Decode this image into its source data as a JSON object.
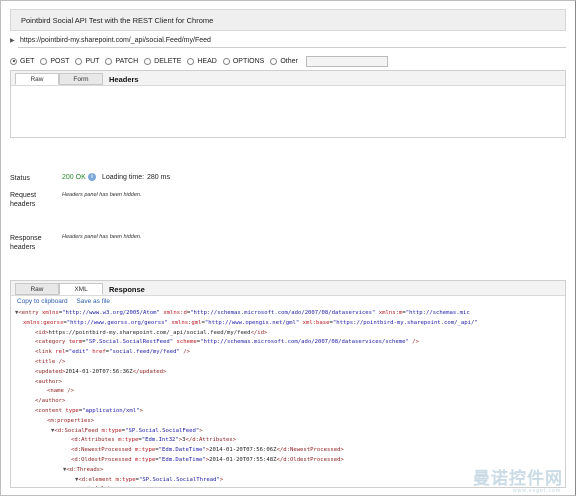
{
  "app": {
    "title": "Pointbird Social API Test with the REST Client for Chrome"
  },
  "request": {
    "url": "https://pointbird-my.sharepoint.com/_api/social.Feed/my/Feed",
    "methods": [
      {
        "label": "GET",
        "selected": true
      },
      {
        "label": "POST",
        "selected": false
      },
      {
        "label": "PUT",
        "selected": false
      },
      {
        "label": "PATCH",
        "selected": false
      },
      {
        "label": "DELETE",
        "selected": false
      },
      {
        "label": "HEAD",
        "selected": false
      },
      {
        "label": "OPTIONS",
        "selected": false
      },
      {
        "label": "Other",
        "selected": false
      }
    ],
    "other_value": "",
    "tabs": {
      "raw": "Raw",
      "form": "Form"
    },
    "headers_title": "Headers"
  },
  "status": {
    "status_label": "Status",
    "status_value": "200 OK",
    "loading_label": "Loading time:",
    "loading_value": "280 ms",
    "req_headers_label": "Request headers",
    "req_headers_note": "Headers panel has been hidden.",
    "resp_headers_label": "Response headers",
    "resp_headers_note": "Headers panel has been hidden."
  },
  "response": {
    "tabs": {
      "raw": "Raw",
      "xml": "XML"
    },
    "title": "Response",
    "copy_link": "Copy to clipboard",
    "save_link": "Save as file",
    "lines": [
      {
        "indent": 0,
        "tri": "▼",
        "html": "<span class='t'>&lt;entry</span> <span class='a'>xmlns</span>=<span class='v'>\"http://www.w3.org/2005/Atom\"</span> <span class='a'>xmlns:d</span>=<span class='v'>\"http://schemas.microsoft.com/ado/2007/08/dataservices\"</span> <span class='a'>xmlns:m</span>=<span class='v'>\"http://schemas.mic</span>"
      },
      {
        "indent": 0,
        "tri": "",
        "html": "<span class='a'>xmlns:georss</span>=<span class='v'>\"http://www.georss.org/georss\"</span> <span class='a'>xmlns:gml</span>=<span class='v'>\"http://www.opengis.net/gml\"</span> <span class='a'>xml:base</span>=<span class='v'>\"https://pointbird-my.sharepoint.com/_api/\"</span>"
      },
      {
        "indent": 1,
        "tri": "",
        "html": "<span class='t'>&lt;id&gt;</span><span class='x'>https://pointbird-my.sharepoint.com/_api/social.feed/my/feed</span><span class='t'>&lt;/id&gt;</span>"
      },
      {
        "indent": 1,
        "tri": "",
        "html": "<span class='t'>&lt;category</span> <span class='a'>term</span>=<span class='v'>\"SP.Social.SocialRestFeed\"</span> <span class='a'>scheme</span>=<span class='v'>\"http://schemas.microsoft.com/ado/2007/08/dataservices/scheme\"</span> <span class='t'>/&gt;</span>"
      },
      {
        "indent": 1,
        "tri": "",
        "html": "<span class='t'>&lt;link</span> <span class='a'>rel</span>=<span class='v'>\"edit\"</span> <span class='a'>href</span>=<span class='v'>\"social.feed/my/feed\"</span> <span class='t'>/&gt;</span>"
      },
      {
        "indent": 1,
        "tri": "",
        "html": "<span class='t'>&lt;title /&gt;</span>"
      },
      {
        "indent": 1,
        "tri": "",
        "html": "<span class='t'>&lt;updated&gt;</span><span class='x'>2014-01-20T07:56:36Z</span><span class='t'>&lt;/updated&gt;</span>"
      },
      {
        "indent": 1,
        "tri": "",
        "html": "<span class='t'>&lt;author&gt;</span>"
      },
      {
        "indent": 2,
        "tri": "",
        "html": "<span class='t'>&lt;name /&gt;</span>"
      },
      {
        "indent": 1,
        "tri": "",
        "html": "<span class='t'>&lt;/author&gt;</span>"
      },
      {
        "indent": 1,
        "tri": "",
        "html": "<span class='t'>&lt;content</span> <span class='a'>type</span>=<span class='v'>\"application/xml\"</span><span class='t'>&gt;</span>"
      },
      {
        "indent": 2,
        "tri": "",
        "html": "<span class='t'>&lt;m:properties&gt;</span>"
      },
      {
        "indent": 3,
        "tri": "▼",
        "html": "<span class='t'>&lt;d:SocialFeed</span> <span class='a'>m:type</span>=<span class='v'>\"SP.Social.SocialFeed\"</span><span class='t'>&gt;</span>"
      },
      {
        "indent": 4,
        "tri": "",
        "html": "<span class='t'>&lt;d:Attributes</span> <span class='a'>m:type</span>=<span class='v'>\"Edm.Int32\"</span><span class='t'>&gt;</span><span class='x'>3</span><span class='t'>&lt;/d:Attributes&gt;</span>"
      },
      {
        "indent": 4,
        "tri": "",
        "html": "<span class='t'>&lt;d:NewestProcessed</span> <span class='a'>m:type</span>=<span class='v'>\"Edm.DateTime\"</span><span class='t'>&gt;</span><span class='x'>2014-01-20T07:56:06Z</span><span class='t'>&lt;/d:NewestProcessed&gt;</span>"
      },
      {
        "indent": 4,
        "tri": "",
        "html": "<span class='t'>&lt;d:OldestProcessed</span> <span class='a'>m:type</span>=<span class='v'>\"Edm.DateTime\"</span><span class='t'>&gt;</span><span class='x'>2014-01-20T07:55:48Z</span><span class='t'>&lt;/d:OldestProcessed&gt;</span>"
      },
      {
        "indent": 4,
        "tri": "▼",
        "html": "<span class='t'>&lt;d:Threads&gt;</span>"
      },
      {
        "indent": 5,
        "tri": "▼",
        "html": "<span class='t'>&lt;d:element</span> <span class='a'>m:type</span>=<span class='v'>\"SP.Social.SocialThread\"</span><span class='t'>&gt;</span>"
      },
      {
        "indent": 6,
        "tri": "▼",
        "html": "<span class='t'>&lt;d:Actors&gt;</span>"
      },
      {
        "indent": 7,
        "tri": "▼",
        "html": "<span class='t'>&lt;d:element</span> <span class='a'>m:type</span>=<span class='v'>\"SP.Social.SocialActor\"</span><span class='t'>&gt;</span>"
      }
    ]
  },
  "watermark": {
    "text": "曼诺控件网",
    "sub": "www.evget.com"
  },
  "colors": {
    "status_ok": "#2a8a2a",
    "link": "#2a5db0",
    "tag": "#8b1a1a",
    "attr": "#b8141e",
    "value": "#1a1aa6"
  },
  "icons": {
    "url_toggle": "triangle-right-icon",
    "status_info": "info-icon"
  }
}
